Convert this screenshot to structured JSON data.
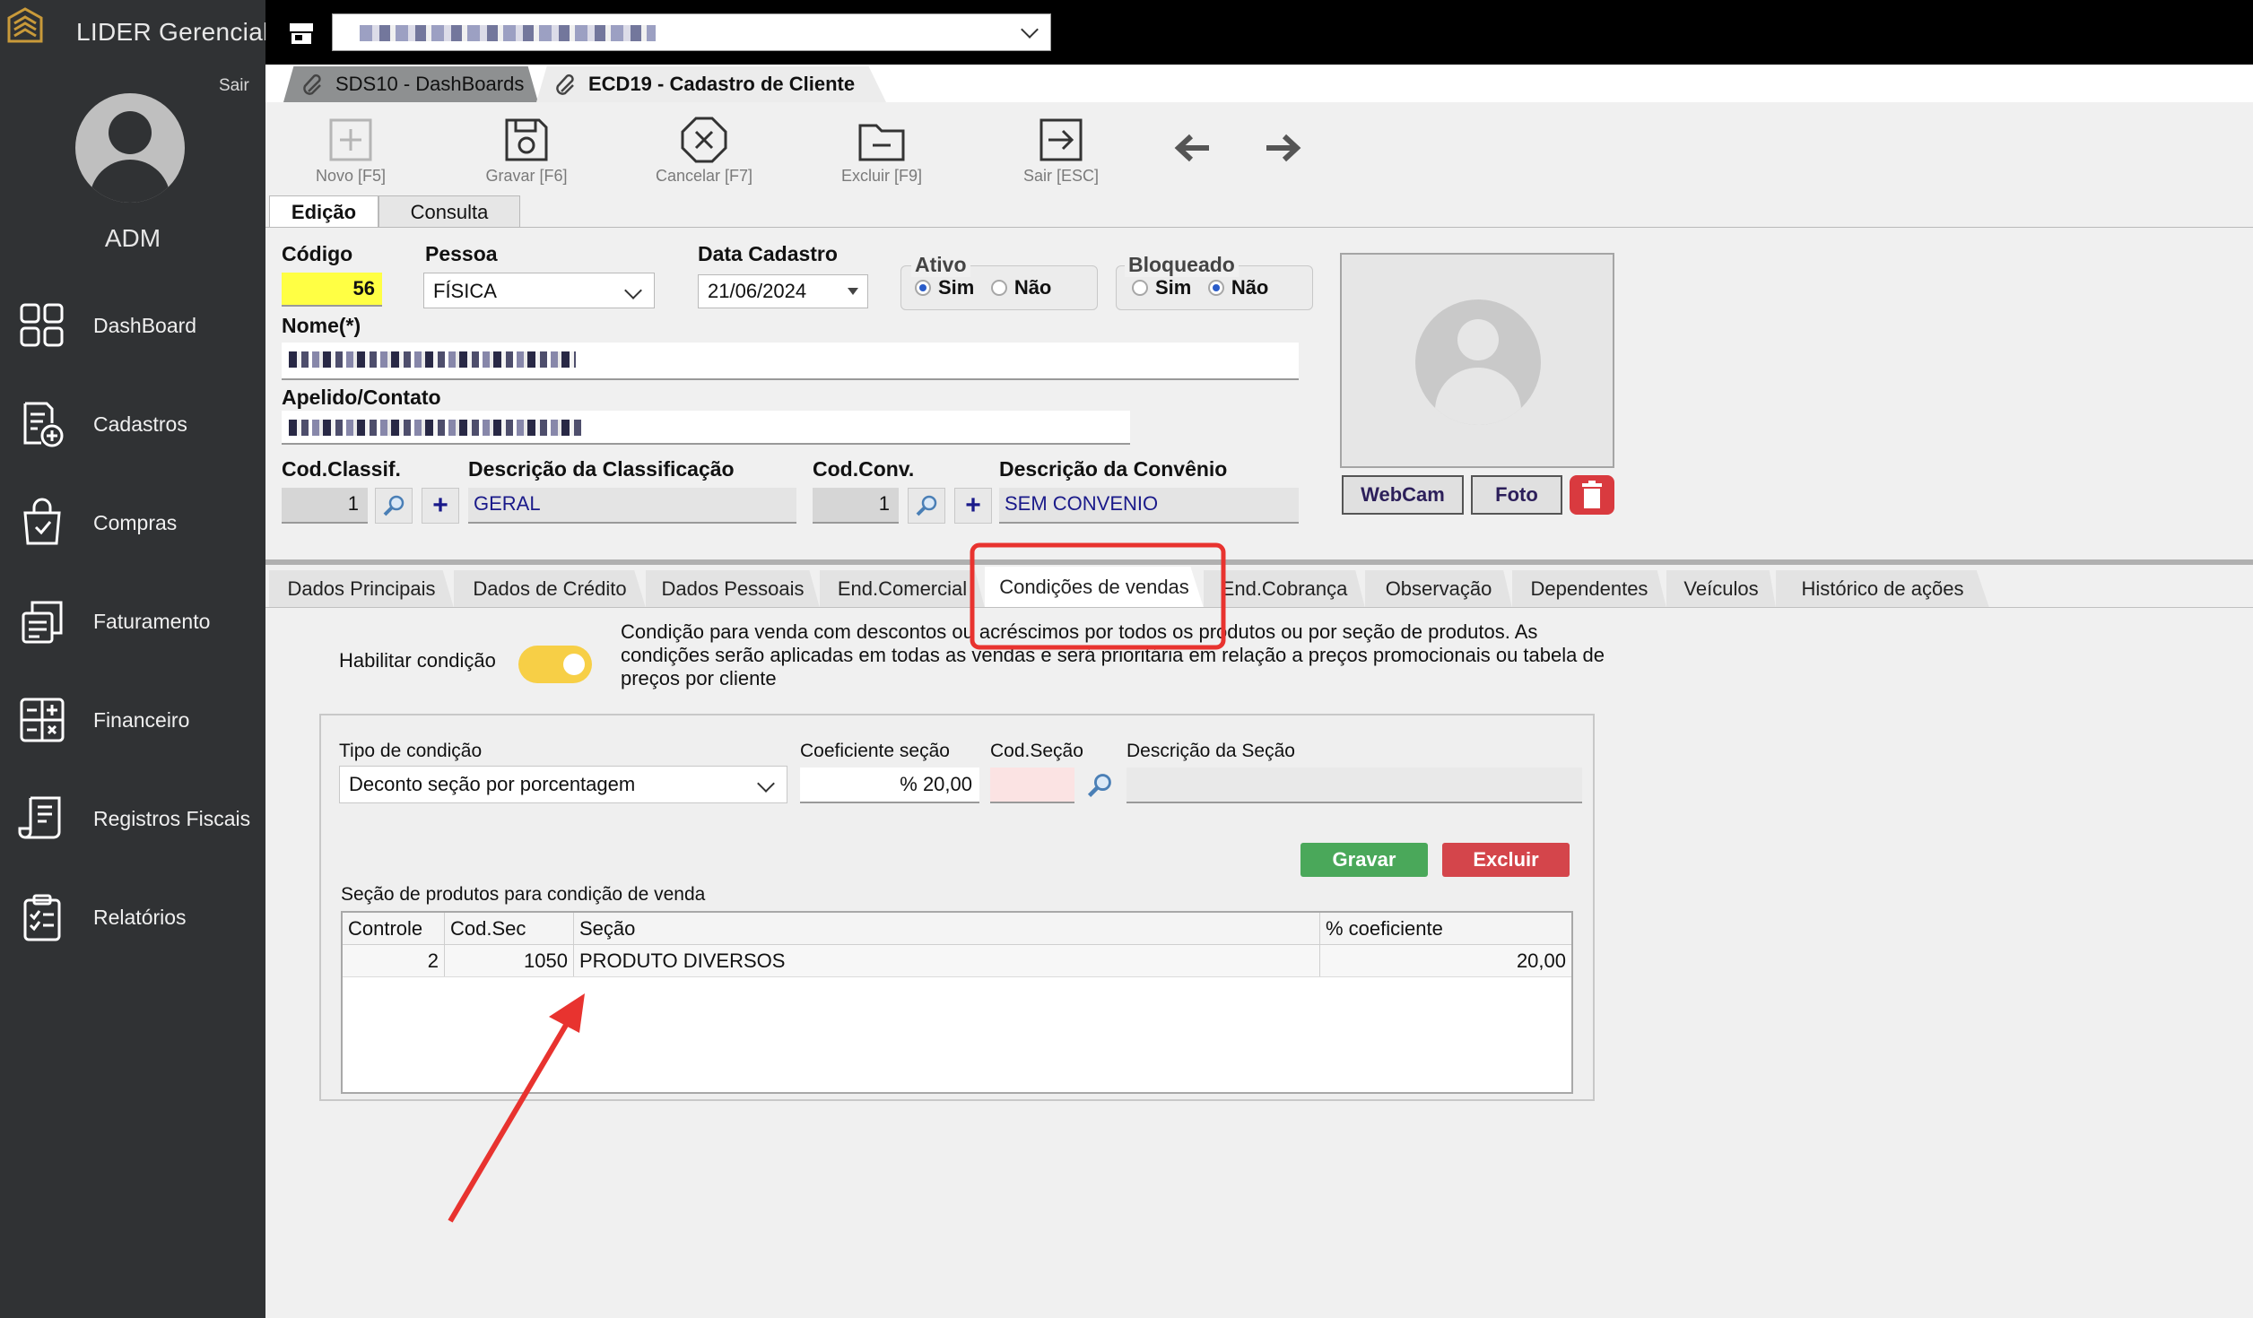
{
  "app": {
    "logo_text": "LIDER Gerencial",
    "logout_label": "Sair",
    "user_name": "ADM"
  },
  "sidebar": {
    "items": [
      {
        "label": "DashBoard",
        "icon": "dashboard-icon"
      },
      {
        "label": "Cadastros",
        "icon": "register-add-icon"
      },
      {
        "label": "Compras",
        "icon": "shopping-bag-icon"
      },
      {
        "label": "Faturamento",
        "icon": "invoice-icon"
      },
      {
        "label": "Financeiro",
        "icon": "calculator-icon"
      },
      {
        "label": "Registros Fiscais",
        "icon": "fiscal-document-icon"
      },
      {
        "label": "Relatórios",
        "icon": "report-clipboard-icon"
      }
    ]
  },
  "topbar": {
    "store_icon": "store-icon"
  },
  "doc_tabs": [
    {
      "label": "SDS10 - DashBoards",
      "icon": "paperclip-icon",
      "active": false
    },
    {
      "label": "ECD19 - Cadastro de Cliente",
      "icon": "paperclip-icon",
      "active": true
    }
  ],
  "toolbar": {
    "new_label": "Novo [F5]",
    "save_label": "Gravar [F6]",
    "cancel_label": "Cancelar [F7]",
    "delete_label": "Excluir [F9]",
    "exit_label": "Sair [ESC]"
  },
  "edit_tabs": {
    "edit_label": "Edição",
    "query_label": "Consulta"
  },
  "form": {
    "codigo_label": "Código",
    "codigo_value": "56",
    "pessoa_label": "Pessoa",
    "pessoa_value": "FÍSICA",
    "data_label": "Data Cadastro",
    "data_value": "21/06/2024",
    "ativo_label": "Ativo",
    "bloqueado_label": "Bloqueado",
    "sim_label": "Sim",
    "nao_label": "Não",
    "ativo_value": "Sim",
    "bloqueado_value": "Não",
    "nome_label": "Nome(*)",
    "apelido_label": "Apelido/Contato",
    "cod_classif_label": "Cod.Classif.",
    "cod_classif_value": "1",
    "desc_classif_label": "Descrição da Classificação",
    "desc_classif_value": "GERAL",
    "cod_conv_label": "Cod.Conv.",
    "cod_conv_value": "1",
    "desc_conv_label": "Descrição da Convênio",
    "desc_conv_value": "SEM CONVENIO"
  },
  "photo": {
    "webcam_label": "WebCam",
    "foto_label": "Foto"
  },
  "bottom_tabs": [
    "Dados Principais",
    "Dados de Crédito",
    "Dados Pessoais",
    "End.Comercial",
    "Condições de vendas",
    "End.Cobrança",
    "Observação",
    "Dependentes",
    "Veículos",
    "Histórico de ações"
  ],
  "active_bottom_tab": "Condições de vendas",
  "conditions": {
    "enable_label": "Habilitar condição",
    "enabled": true,
    "description": "Condição para venda com descontos ou acréscimos por todos os produtos ou por seção de produtos. As condições serão aplicadas em todas as vendas e será prioritária em relação a preços promocionais ou tabela de preços por cliente",
    "tipo_label": "Tipo de condição",
    "tipo_value": "Deconto seção por porcentagem",
    "coef_label": "Coeficiente seção",
    "coef_value": "% 20,00",
    "codsecao_label": "Cod.Seção",
    "codsecao_value": "",
    "descsecao_label": "Descrição da Seção",
    "descsecao_value": "",
    "save_label": "Gravar",
    "delete_label": "Excluir",
    "grid_title": "Seção de produtos para condição de venda",
    "columns": [
      "Controle",
      "Cod.Sec",
      "Seção",
      "% coeficiente"
    ],
    "rows": [
      {
        "controle": "2",
        "cod_sec": "1050",
        "secao": "PRODUTO DIVERSOS",
        "coef": "20,00"
      }
    ]
  },
  "colors": {
    "sidebar_bg": "#303234",
    "topbar_bg": "#000000",
    "content_bg": "#f0f0f0",
    "highlight_yellow": "#ffff44",
    "toggle_on": "#f7cf46",
    "save_green": "#4aa85a",
    "delete_red": "#d4454b",
    "annotation_red": "#e8332f"
  }
}
